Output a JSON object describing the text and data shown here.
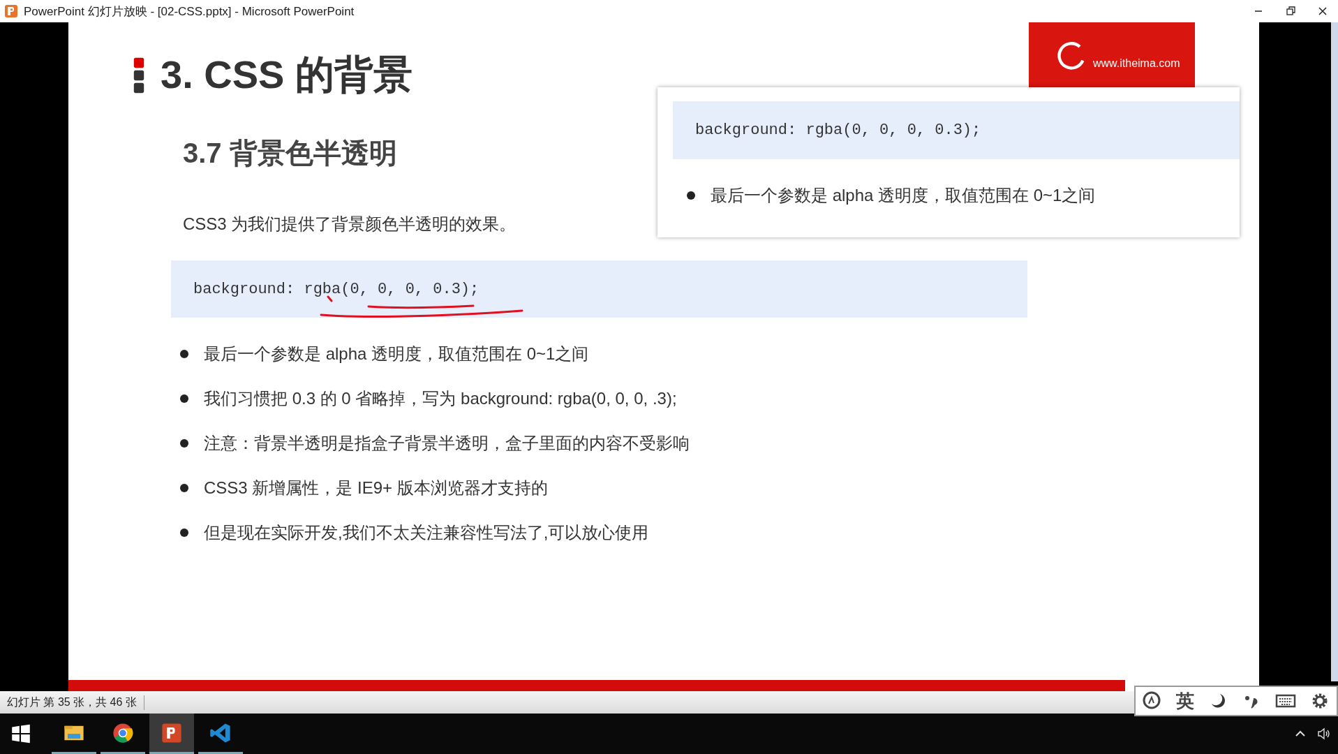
{
  "window": {
    "title": "PowerPoint 幻灯片放映 - [02-CSS.pptx] - Microsoft PowerPoint"
  },
  "slide": {
    "title": "3. CSS 的背景",
    "subtitle": "3.7 背景色半透明",
    "intro": "CSS3 为我们提供了背景颜色半透明的效果。",
    "code": "background: rgba(0, 0, 0, 0.3);",
    "bullets": [
      "最后一个参数是 alpha 透明度，取值范围在 0~1之间",
      "我们习惯把 0.3 的 0 省略掉，写为 background: rgba(0, 0, 0, .3);",
      "注意：背景半透明是指盒子背景半透明，盒子里面的内容不受影响",
      "CSS3 新增属性，是 IE9+ 版本浏览器才支持的",
      "但是现在实际开发,我们不太关注兼容性写法了,可以放心使用"
    ],
    "logo": {
      "url": "www.itheima.com"
    },
    "popup": {
      "code": "background: rgba(0, 0, 0, 0.3);",
      "bullets": [
        "最后一个参数是 alpha 透明度，取值范围在 0~1之间"
      ]
    }
  },
  "status_bar": {
    "text": "幻灯片 第 35 张，共 46 张"
  },
  "ime_bar": {
    "language": "英"
  },
  "taskbar": {
    "apps": [
      {
        "kind": "explorer",
        "selected": false
      },
      {
        "kind": "chrome",
        "selected": false
      },
      {
        "kind": "powerpoint",
        "selected": true
      },
      {
        "kind": "vscode",
        "selected": false
      }
    ]
  }
}
